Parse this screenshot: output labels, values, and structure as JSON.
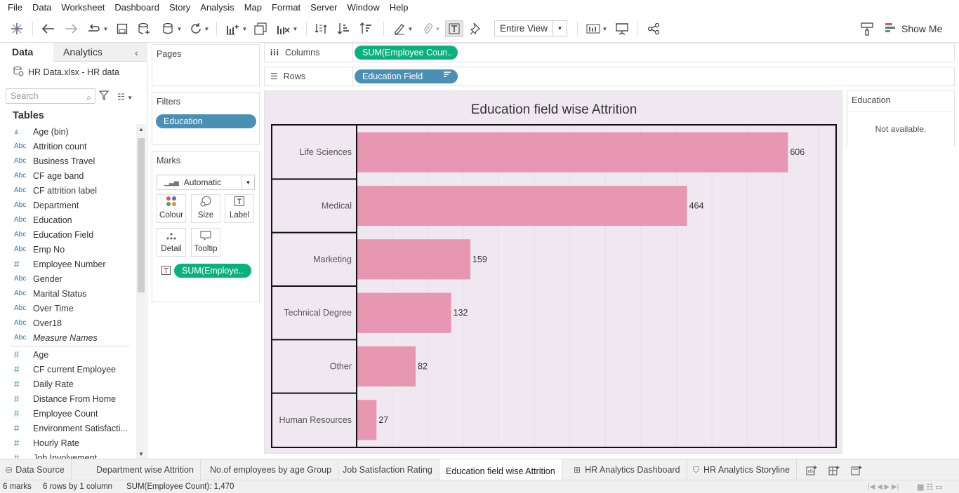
{
  "menu": [
    "File",
    "Data",
    "Worksheet",
    "Dashboard",
    "Story",
    "Analysis",
    "Map",
    "Format",
    "Server",
    "Window",
    "Help"
  ],
  "toolbar": {
    "view_select": "Entire View",
    "show_me": "Show Me"
  },
  "left_pane": {
    "tab_data": "Data",
    "tab_analytics": "Analytics",
    "datasource": "HR Data.xlsx - HR data",
    "search_placeholder": "Search",
    "tables_heading": "Tables",
    "dimensions": [
      {
        "type": "bin",
        "name": "Age (bin)"
      },
      {
        "type": "Abc",
        "name": "Attrition count"
      },
      {
        "type": "Abc",
        "name": "Business Travel"
      },
      {
        "type": "Abc",
        "name": "CF age band"
      },
      {
        "type": "Abc",
        "name": "CF attrition label"
      },
      {
        "type": "Abc",
        "name": "Department"
      },
      {
        "type": "Abc",
        "name": "Education"
      },
      {
        "type": "Abc",
        "name": "Education Field"
      },
      {
        "type": "Abc",
        "name": "Emp No"
      },
      {
        "type": "#",
        "name": "Employee Number"
      },
      {
        "type": "Abc",
        "name": "Gender"
      },
      {
        "type": "Abc",
        "name": "Marital Status"
      },
      {
        "type": "Abc",
        "name": "Over Time"
      },
      {
        "type": "Abc",
        "name": "Over18"
      },
      {
        "type": "Abc",
        "name": "Measure Names",
        "italic": true
      }
    ],
    "measures": [
      {
        "type": "#",
        "name": "Age"
      },
      {
        "type": "#",
        "name": "CF current Employee"
      },
      {
        "type": "#",
        "name": "Daily Rate"
      },
      {
        "type": "#",
        "name": "Distance From Home"
      },
      {
        "type": "#",
        "name": "Employee Count"
      },
      {
        "type": "#",
        "name": "Environment Satisfacti..."
      },
      {
        "type": "#",
        "name": "Hourly Rate"
      },
      {
        "type": "#",
        "name": "Job Involvement"
      }
    ]
  },
  "pages": {
    "title": "Pages"
  },
  "filters": {
    "title": "Filters",
    "pill": "Education"
  },
  "marks": {
    "title": "Marks",
    "type": "Automatic",
    "buttons": [
      "Colour",
      "Size",
      "Label",
      "Detail",
      "Tooltip"
    ],
    "pill": "SUM(Employe.."
  },
  "shelves": {
    "columns_label": "Columns",
    "columns_pill": "SUM(Employee Coun..",
    "rows_label": "Rows",
    "rows_pill": "Education Field"
  },
  "legend": {
    "title": "Education",
    "message": "Not available."
  },
  "chart_data": {
    "type": "bar",
    "orientation": "horizontal",
    "title": "Education field wise Attrition",
    "categories": [
      "Life Sciences",
      "Medical",
      "Marketing",
      "Technical Degree",
      "Other",
      "Human Resources"
    ],
    "values": [
      606,
      464,
      159,
      132,
      82,
      27
    ],
    "bar_color": "#e897b2",
    "background": "#f0e8f1",
    "grid": true,
    "xlim": [
      0,
      660
    ]
  },
  "sheet_tabs": {
    "data_source": "Data Source",
    "tabs": [
      "Department wise Attrition",
      "No.of employees by age Group",
      "Job Satisfaction Rating",
      "Education field wise Attrition",
      "HR Analytics Dashboard",
      "HR Analytics Storyline"
    ],
    "active": "Education field wise Attrition"
  },
  "status": {
    "marks": "6 marks",
    "rows": "6 rows  by  1 column",
    "sum": "SUM(Employee Count): 1,470"
  },
  "colors": {
    "green_pill": "#0bb17c",
    "blue_pill": "#4a90b5",
    "accent": "#e897b2"
  }
}
